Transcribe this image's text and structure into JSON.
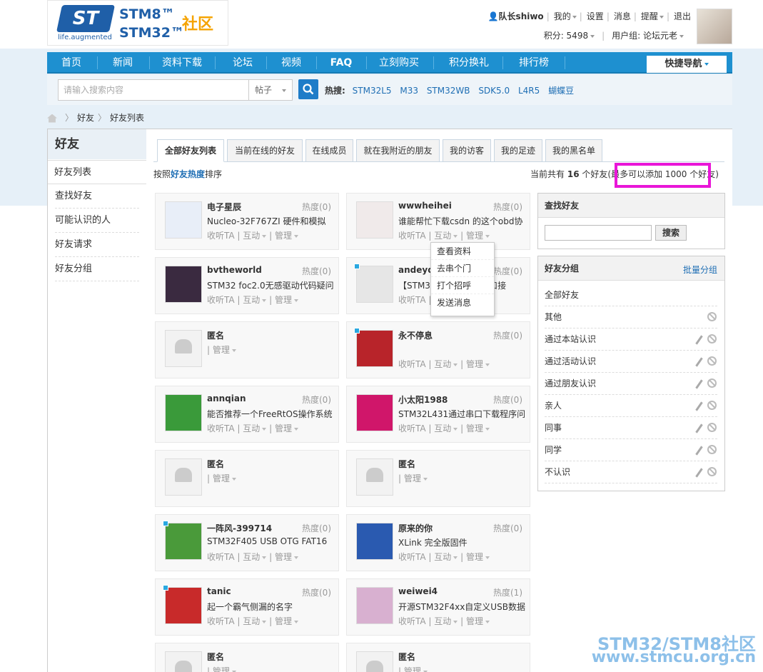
{
  "header": {
    "logo": {
      "st": "ST",
      "tagline": "life.augmented",
      "stm8": "STM8™",
      "stm32": "STM32™",
      "community": "社区"
    },
    "user": {
      "name": "队长shiwo",
      "my": "我的",
      "settings": "设置",
      "messages": "消息",
      "reminders": "提醒",
      "logout": "退出"
    },
    "points": "积分: 5498",
    "usergroup": "用户组: 论坛元老"
  },
  "nav": {
    "items": [
      "首页",
      "新闻",
      "资料下载",
      "论坛",
      "视频",
      "FAQ",
      "立刻购买",
      "积分换礼",
      "排行榜"
    ],
    "quick": "快捷导航"
  },
  "search": {
    "placeholder": "请输入搜索内容",
    "scope": "帖子",
    "hot_label": "热搜:",
    "hot": [
      "STM32L5",
      "M33",
      "STM32WB",
      "SDK5.0",
      "L4R5",
      "蝴蝶豆"
    ]
  },
  "breadcrumb": [
    "好友",
    "好友列表"
  ],
  "sidebar": {
    "title": "好友",
    "items": [
      "好友列表",
      "查找好友",
      "可能认识的人",
      "好友请求",
      "好友分组"
    ]
  },
  "tabs": [
    "全部好友列表",
    "当前在线的好友",
    "在线成员",
    "就在我附近的朋友",
    "我的访客",
    "我的足迹",
    "我的黑名单"
  ],
  "sort": {
    "prefix": "按照",
    "key": "好友热度",
    "suffix": "排序"
  },
  "count": {
    "text": "当前共有",
    "num": "16",
    "unit": "个好友",
    "limit": "(最多可以添加 1000 个好友)"
  },
  "actions": {
    "listen": "收听TA",
    "interact": "互动",
    "manage": "管理"
  },
  "friends": [
    {
      "name": "电子星辰",
      "heat": "热度(0)",
      "desc": "Nucleo-32F767ZI 硬件和模拟",
      "online": false,
      "anon": false,
      "color": "#e8eef8"
    },
    {
      "name": "wwwheihei",
      "heat": "热度(0)",
      "desc": "谁能帮忙下载csdn 的这个obd协",
      "online": false,
      "anon": false,
      "color": "#f0eaea"
    },
    {
      "name": "bvtheworld",
      "heat": "热度(0)",
      "desc": "STM32 foc2.0无感驱动代码疑问",
      "online": false,
      "anon": false,
      "color": "#3a2a40"
    },
    {
      "name": "andeyqi",
      "heat": "热度(0)",
      "desc": "【STM32F7开发板】串口接",
      "online": true,
      "anon": false,
      "color": "#e6e6e6"
    },
    {
      "name": "匿名",
      "heat": "",
      "desc": "",
      "online": false,
      "anon": true,
      "color": "#f2f2f2"
    },
    {
      "name": "永不停息",
      "heat": "热度(0)",
      "desc": "",
      "online": true,
      "anon": false,
      "color": "#b8242a"
    },
    {
      "name": "annqian",
      "heat": "热度(0)",
      "desc": "能否推荐一个FreeRtOS操作系统",
      "online": false,
      "anon": false,
      "color": "#3a9a3a"
    },
    {
      "name": "小太阳1988",
      "heat": "热度(0)",
      "desc": "STM32L431通过串口下载程序问",
      "online": false,
      "anon": false,
      "color": "#d0166a"
    },
    {
      "name": "匿名",
      "heat": "",
      "desc": "",
      "online": false,
      "anon": true,
      "color": "#f2f2f2"
    },
    {
      "name": "匿名",
      "heat": "",
      "desc": "",
      "online": false,
      "anon": true,
      "color": "#f2f2f2"
    },
    {
      "name": "一阵风-399714",
      "heat": "热度(0)",
      "desc": "STM32F405 USB OTG FAT16",
      "online": true,
      "anon": false,
      "color": "#4a9a3a"
    },
    {
      "name": "原来的你",
      "heat": "热度(0)",
      "desc": "XLink 完全版固件",
      "online": false,
      "anon": false,
      "color": "#2a5ab0"
    },
    {
      "name": "tanic",
      "heat": "热度(0)",
      "desc": "起一个霸气侧漏的名字",
      "online": true,
      "anon": false,
      "color": "#c82a2a"
    },
    {
      "name": "weiwei4",
      "heat": "热度(1)",
      "desc": "开源STM32F4xx自定义USB数据",
      "online": false,
      "anon": false,
      "color": "#d8b0d0"
    },
    {
      "name": "匿名",
      "heat": "",
      "desc": "",
      "online": false,
      "anon": true,
      "color": "#f2f2f2"
    },
    {
      "name": "匿名",
      "heat": "",
      "desc": "",
      "online": false,
      "anon": true,
      "color": "#f2f2f2"
    }
  ],
  "popup_menu": [
    "查看资料",
    "去串个门",
    "打个招呼",
    "发送消息"
  ],
  "find_panel": {
    "title": "查找好友",
    "button": "搜索"
  },
  "group_panel": {
    "title": "好友分组",
    "batch": "批量分组",
    "groups": [
      "全部好友",
      "其他",
      "通过本站认识",
      "通过活动认识",
      "通过朋友认识",
      "亲人",
      "同事",
      "同学",
      "不认识"
    ]
  },
  "watermark": {
    "line1": "STM32/STM8社区",
    "line2": "www.stmcu.org.cn"
  }
}
